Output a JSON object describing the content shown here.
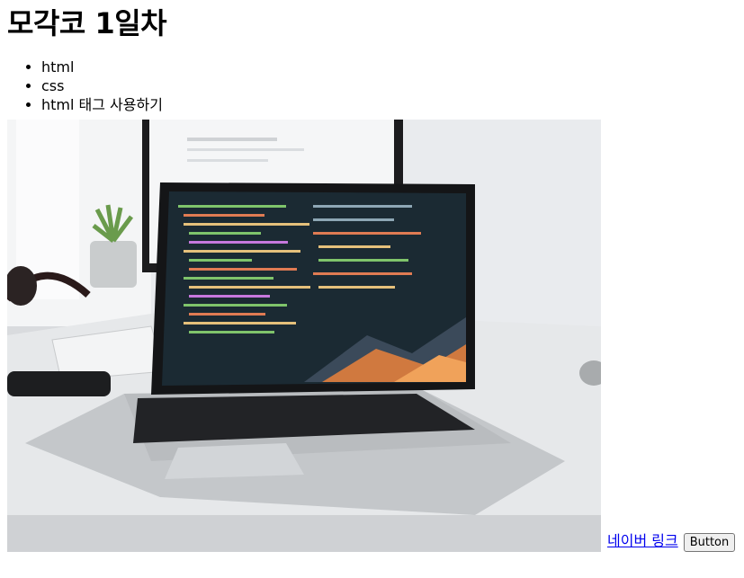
{
  "page": {
    "title": "모각코 1일차",
    "list_items": [
      "html",
      "css",
      "html 태그 사용하기"
    ],
    "image_alt": "laptop on desk showing code editor",
    "link_label": "네이버 링크",
    "button_label": "Button"
  }
}
